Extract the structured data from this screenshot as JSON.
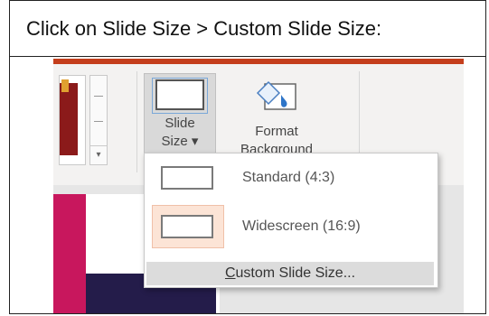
{
  "caption": "Click on Slide Size > Custom Slide Size:",
  "ribbon": {
    "slide_size_line1": "Slide",
    "slide_size_line2": "Size ▾",
    "format_bg_line1": "Format",
    "format_bg_line2": "Background"
  },
  "dropdown": {
    "standard_label": "Standard (4:3)",
    "widescreen_label": "Widescreen (16:9)",
    "custom_first_letter": "C",
    "custom_rest": "ustom Slide Size..."
  },
  "colors": {
    "accent": "#c43e1c",
    "selected_bg": "#fce4d6",
    "magenta": "#c8175d",
    "navy": "#241c4a"
  }
}
